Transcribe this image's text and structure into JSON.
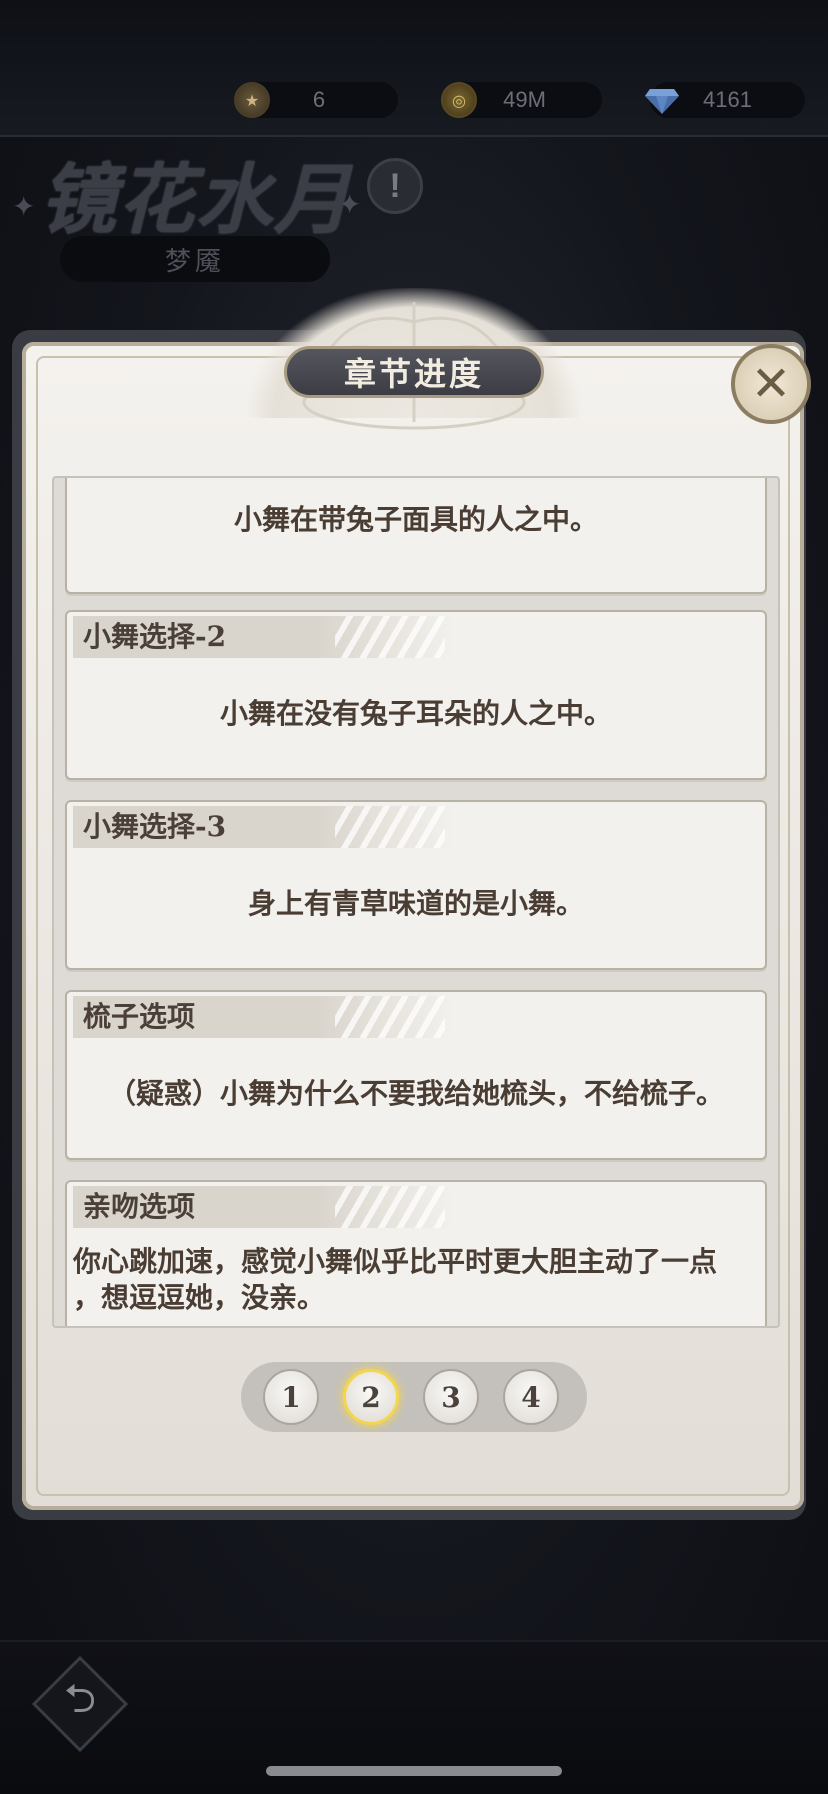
{
  "currencies": [
    {
      "icon": "medal-icon",
      "value": "6"
    },
    {
      "icon": "gold-coin-icon",
      "value": "49M"
    },
    {
      "icon": "diamond-icon",
      "value": "4161"
    }
  ],
  "background": {
    "title": "镜花水月",
    "info_symbol": "!",
    "mode_label": "梦魇"
  },
  "modal": {
    "title": "章节进度",
    "close_symbol": "✕",
    "cards": [
      {
        "title": "",
        "text": "小舞在带兔子面具的人之中。"
      },
      {
        "title": "小舞选择-2",
        "text": "小舞在没有兔子耳朵的人之中。"
      },
      {
        "title": "小舞选择-3",
        "text": "身上有青草味道的是小舞。"
      },
      {
        "title": "梳子选项",
        "text": "（疑惑）小舞为什么不要我给她梳头，不给梳子。"
      },
      {
        "title": "亲吻选项",
        "text_line1": "你心跳加速，感觉小舞似乎比平时更大胆主动了一点",
        "text_line2": "，想逗逗她，没亲。"
      }
    ],
    "pages": [
      "1",
      "2",
      "3",
      "4"
    ],
    "current_page": "2"
  },
  "bottom": {
    "back_icon": "return-arrow-icon",
    "back_symbol": "⮌"
  },
  "colors": {
    "accent_gold": "#f5d54e",
    "banner": "#45464d",
    "card_text": "#4a3d34"
  }
}
